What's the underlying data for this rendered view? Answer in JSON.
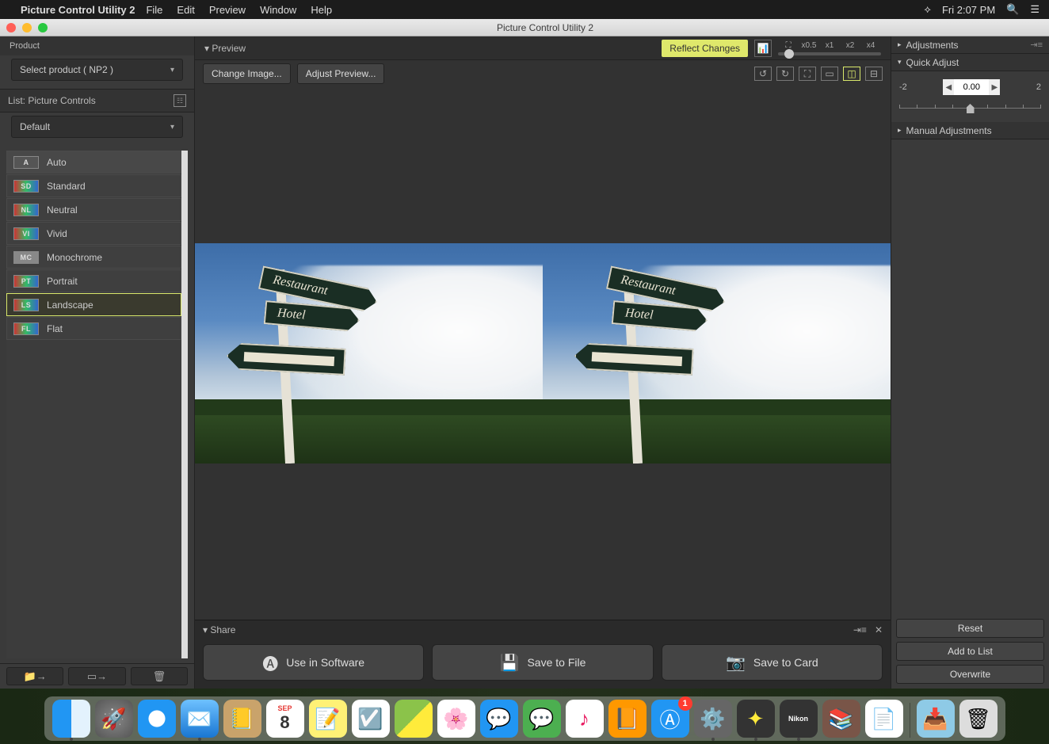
{
  "menubar": {
    "app_name": "Picture Control Utility 2",
    "items": [
      "File",
      "Edit",
      "Preview",
      "Window",
      "Help"
    ],
    "time": "Fri 2:07 PM"
  },
  "titlebar": {
    "title": "Picture Control Utility 2"
  },
  "sidebar": {
    "product_label": "Product",
    "product_value": "Select product ( NP2 )",
    "list_label": "List: Picture Controls",
    "listset_value": "Default",
    "items": [
      {
        "code": "A",
        "label": "Auto",
        "auto": true
      },
      {
        "code": "SD",
        "label": "Standard"
      },
      {
        "code": "NL",
        "label": "Neutral"
      },
      {
        "code": "VI",
        "label": "Vivid"
      },
      {
        "code": "MC",
        "label": "Monochrome",
        "mono": true
      },
      {
        "code": "PT",
        "label": "Portrait"
      },
      {
        "code": "LS",
        "label": "Landscape",
        "selected": true
      },
      {
        "code": "FL",
        "label": "Flat"
      }
    ]
  },
  "preview_bar": {
    "label": "Preview",
    "reflect": "Reflect Changes",
    "zoom_levels": [
      "x0.5",
      "x1",
      "x2",
      "x4"
    ]
  },
  "action_bar": {
    "change_image": "Change Image...",
    "adjust_preview": "Adjust Preview..."
  },
  "previews": {
    "sign1": "Restaurant",
    "sign2": "Hotel"
  },
  "share": {
    "label": "Share",
    "use_in_software": "Use in Software",
    "save_to_file": "Save to File",
    "save_to_card": "Save to Card"
  },
  "right": {
    "adjustments": "Adjustments",
    "quick_adjust": "Quick Adjust",
    "qa_min": "-2",
    "qa_max": "2",
    "qa_value": "0.00",
    "manual": "Manual Adjustments",
    "reset": "Reset",
    "add_to_list": "Add to List",
    "overwrite": "Overwrite"
  },
  "dock": {
    "cal_month": "SEP",
    "cal_day": "8",
    "appstore_badge": "1",
    "pc_label": "Nikon"
  }
}
